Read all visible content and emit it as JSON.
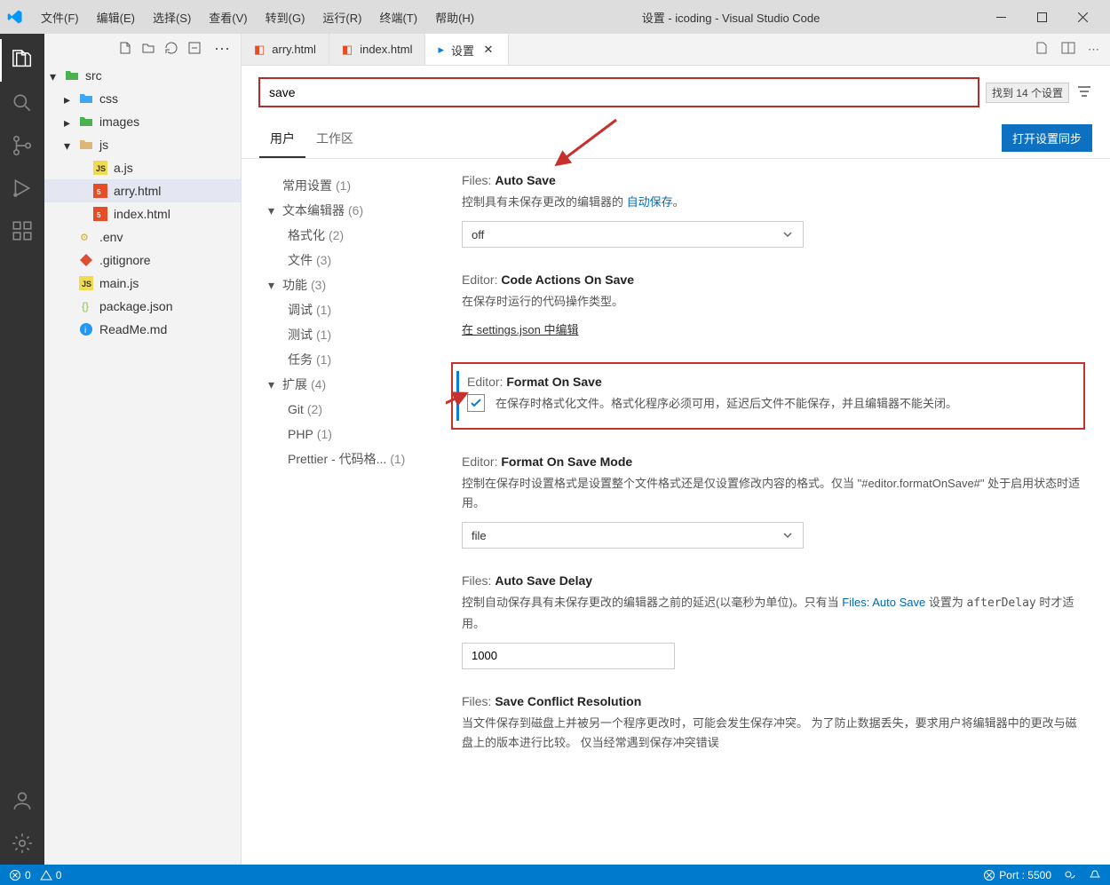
{
  "window": {
    "title": "设置 - icoding - Visual Studio Code",
    "menu": [
      "文件(F)",
      "编辑(E)",
      "选择(S)",
      "查看(V)",
      "转到(G)",
      "运行(R)",
      "终端(T)",
      "帮助(H)"
    ]
  },
  "tabs": [
    {
      "icon": "html",
      "label": "arry.html"
    },
    {
      "icon": "html",
      "label": "index.html"
    },
    {
      "icon": "settings",
      "label": "设置",
      "active": true
    }
  ],
  "tree": [
    {
      "indent": 0,
      "chev": "down",
      "icon": "folder-green",
      "label": "src"
    },
    {
      "indent": 1,
      "chev": "right",
      "icon": "folder-blue",
      "label": "css"
    },
    {
      "indent": 1,
      "chev": "right",
      "icon": "folder-green",
      "label": "images"
    },
    {
      "indent": 1,
      "chev": "down",
      "icon": "folder-yellow",
      "label": "js"
    },
    {
      "indent": 2,
      "icon": "js-file",
      "label": "a.js"
    },
    {
      "indent": 2,
      "icon": "html-file",
      "label": "arry.html",
      "selected": true
    },
    {
      "indent": 2,
      "icon": "html-file",
      "label": "index.html"
    },
    {
      "indent": 1,
      "icon": "env-file",
      "label": ".env"
    },
    {
      "indent": 1,
      "icon": "git-file",
      "label": ".gitignore"
    },
    {
      "indent": 1,
      "icon": "js-file-y",
      "label": "main.js"
    },
    {
      "indent": 1,
      "icon": "json-file",
      "label": "package.json"
    },
    {
      "indent": 1,
      "icon": "info-file",
      "label": "ReadMe.md"
    }
  ],
  "search": {
    "value": "save",
    "result": "找到 14 个设置"
  },
  "scope": {
    "user": "用户",
    "workspace": "工作区",
    "sync": "打开设置同步"
  },
  "toc": [
    {
      "l": 1,
      "label": "常用设置",
      "count": "(1)"
    },
    {
      "l": 1,
      "chev": "down",
      "label": "文本编辑器",
      "count": "(6)"
    },
    {
      "l": 2,
      "label": "格式化",
      "count": "(2)"
    },
    {
      "l": 2,
      "label": "文件",
      "count": "(3)"
    },
    {
      "l": 1,
      "chev": "down",
      "label": "功能",
      "count": "(3)"
    },
    {
      "l": 2,
      "label": "调试",
      "count": "(1)"
    },
    {
      "l": 2,
      "label": "测试",
      "count": "(1)"
    },
    {
      "l": 2,
      "label": "任务",
      "count": "(1)"
    },
    {
      "l": 1,
      "chev": "down",
      "label": "扩展",
      "count": "(4)"
    },
    {
      "l": 2,
      "label": "Git",
      "count": "(2)"
    },
    {
      "l": 2,
      "label": "PHP",
      "count": "(1)"
    },
    {
      "l": 2,
      "label": "Prettier - 代码格...",
      "count": "(1)"
    }
  ],
  "settings": {
    "autoSave": {
      "cat": "Files:",
      "name": "Auto Save",
      "desc1": "控制具有未保存更改的编辑器的 ",
      "link": "自动保存",
      "desc2": "。",
      "value": "off"
    },
    "codeActionsOnSave": {
      "cat": "Editor:",
      "name": "Code Actions On Save",
      "desc": "在保存时运行的代码操作类型。",
      "edit": "在 settings.json 中编辑"
    },
    "formatOnSave": {
      "cat": "Editor:",
      "name": "Format On Save",
      "desc": "在保存时格式化文件。格式化程序必须可用，延迟后文件不能保存，并且编辑器不能关闭。"
    },
    "formatOnSaveMode": {
      "cat": "Editor:",
      "name": "Format On Save Mode",
      "desc": "控制在保存时设置格式是设置整个文件格式还是仅设置修改内容的格式。仅当 \"#editor.formatOnSave#\" 处于启用状态时适用。",
      "value": "file"
    },
    "autoSaveDelay": {
      "cat": "Files:",
      "name": "Auto Save Delay",
      "desc1": "控制自动保存具有未保存更改的编辑器之前的延迟(以毫秒为单位)。只有当 ",
      "link": "Files: Auto Save",
      "desc2": " 设置为 ",
      "code": "afterDelay",
      "desc3": " 时才适用。",
      "value": "1000"
    },
    "saveConflict": {
      "cat": "Files:",
      "name": "Save Conflict Resolution",
      "desc": "当文件保存到磁盘上并被另一个程序更改时，可能会发生保存冲突。 为了防止数据丢失，要求用户将编辑器中的更改与磁盘上的版本进行比较。 仅当经常遇到保存冲突错误"
    }
  },
  "annotations": {
    "check": "勾选"
  },
  "status": {
    "errors": "0",
    "warnings": "0",
    "port": "Port : 5500"
  }
}
